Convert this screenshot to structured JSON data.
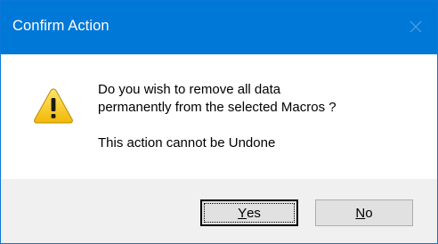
{
  "window": {
    "title": "Confirm Action",
    "close_icon": "close-icon",
    "titlebar_color": "#0078d7"
  },
  "message": {
    "icon": "warning-icon",
    "line1": "Do you wish to remove all data",
    "line2": "permanently from the selected Macros ?",
    "line3": "This action cannot be Undone"
  },
  "buttons": {
    "yes": {
      "mnemonic": "Y",
      "rest": "es",
      "default": true
    },
    "no": {
      "mnemonic": "N",
      "rest": "o",
      "default": false
    }
  }
}
